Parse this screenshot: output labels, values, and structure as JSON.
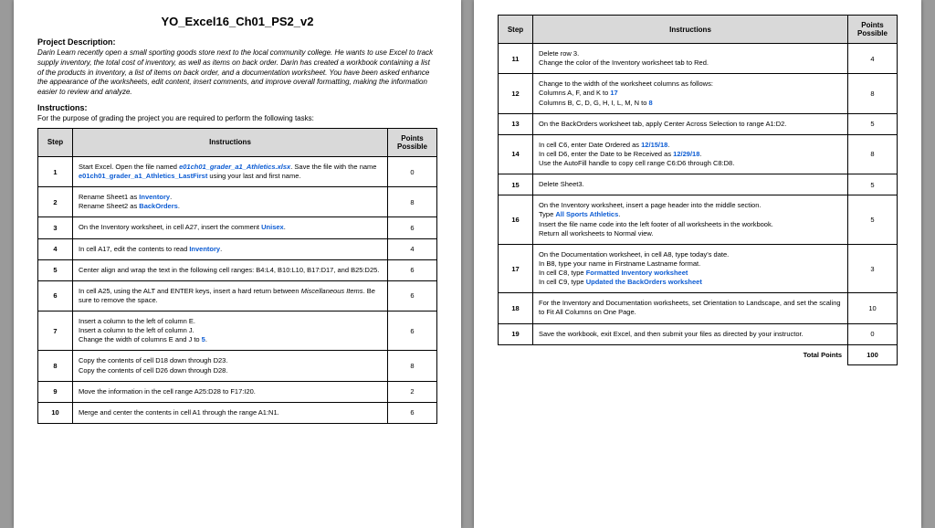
{
  "doc": {
    "title": "YO_Excel16_Ch01_PS2_v2",
    "project_description_heading": "Project Description:",
    "project_description": "Darin Learn recently open a small sporting goods store next to the local community college. He wants to use Excel to track supply inventory, the total cost of inventory, as well as items on back order. Darin has created a workbook containing a list of the products in inventory, a list of items on back order, and a documentation worksheet. You have been asked enhance the appearance of the worksheets, edit content, insert comments, and improve overall formatting, making the information easier to review and analyze.",
    "instructions_heading": "Instructions:",
    "instructions_lead": "For the purpose of grading the project you are required to perform the following tasks:",
    "col_step": "Step",
    "col_instructions": "Instructions",
    "col_points": "Points Possible",
    "total_label": "Total Points",
    "total_value": "100"
  },
  "steps1": [
    {
      "n": "1",
      "pts": "0",
      "l1": "Start Excel. Open the file named ",
      "f1": "e01ch01_grader_a1_Athletics.xlsx",
      "l2": ". Save the file with the name ",
      "f2": "e01ch01_grader_a1_Athletics_LastFirst",
      "l3": " using your last and first name."
    },
    {
      "n": "2",
      "pts": "8",
      "l1": "Rename Sheet1 as ",
      "k1": "Inventory",
      "l2": ".",
      "l3": "Rename Sheet2 as ",
      "k2": "BackOrders",
      "l4": "."
    },
    {
      "n": "3",
      "pts": "6",
      "l1": "On the Inventory worksheet, in cell A27, insert the comment ",
      "k1": "Unisex",
      "l2": "."
    },
    {
      "n": "4",
      "pts": "4",
      "l1": "In cell A17, edit the contents to read ",
      "k1": "Inventory",
      "l2": "."
    },
    {
      "n": "5",
      "pts": "6",
      "l1": "Center align and wrap the text in the following cell ranges: B4:L4, B10:L10, B17:D17, and B25:D25."
    },
    {
      "n": "6",
      "pts": "6",
      "l1": "In cell A25, using the ALT and ENTER keys, insert a hard return between ",
      "it": "Miscellaneous Items",
      "l2": ". Be sure to remove the space."
    },
    {
      "n": "7",
      "pts": "6",
      "l1": "Insert a column to the left of column E.",
      "l2": "Insert a column to the left of column J.",
      "l3": "Change the width of columns E and J to ",
      "k1": "5",
      "l4": "."
    },
    {
      "n": "8",
      "pts": "8",
      "l1": "Copy the contents of cell D18 down through D23.",
      "l2": "Copy the contents of cell D26 down through D28."
    },
    {
      "n": "9",
      "pts": "2",
      "l1": "Move the information in the cell range A25:D28 to F17:I20."
    },
    {
      "n": "10",
      "pts": "6",
      "l1": "Merge and center the contents in cell A1 through the range A1:N1."
    }
  ],
  "steps2": [
    {
      "n": "11",
      "pts": "4",
      "l1": "Delete row 3.",
      "l2": "Change the color of the Inventory worksheet tab to Red."
    },
    {
      "n": "12",
      "pts": "8",
      "l1": "Change to the width of the worksheet columns as follows:",
      "l2": "Columns A, F, and K to ",
      "k1": "17",
      "l3": "Columns B, C, D, G, H, I, L, M, N to ",
      "k2": "8"
    },
    {
      "n": "13",
      "pts": "5",
      "l1": "On the BackOrders worksheet tab, apply Center Across Selection to range A1:D2."
    },
    {
      "n": "14",
      "pts": "8",
      "l1": "In cell C6, enter Date Ordered as ",
      "k1": "12/15/18",
      "l2": ".",
      "l3": "In cell D6, enter the Date to be Received as ",
      "k2": "12/29/18",
      "l4": ".",
      "l5": "Use the AutoFill handle to copy cell range C6:D6 through C8:D8."
    },
    {
      "n": "15",
      "pts": "5",
      "l1": "Delete Sheet3."
    },
    {
      "n": "16",
      "pts": "5",
      "l1": "On the Inventory worksheet, insert a page header into the middle section.",
      "l2": "Type ",
      "k1": "All Sports Athletics",
      "l3": ".",
      "l4": "Insert the file name code into the left footer of all worksheets in the workbook.",
      "l5": "Return all worksheets to Normal view."
    },
    {
      "n": "17",
      "pts": "3",
      "l1": "On the Documentation worksheet, in cell A8, type today's date.",
      "l2": "In B8, type your name in Firstname Lastname format.",
      "l3": "In cell C8, type ",
      "k1": "Formatted Inventory worksheet",
      "l4": "In cell C9, type ",
      "k2": "Updated the BackOrders worksheet"
    },
    {
      "n": "18",
      "pts": "10",
      "l1": "For the Inventory and Documentation worksheets, set Orientation to Landscape, and set the scaling to Fit All Columns on One Page."
    },
    {
      "n": "19",
      "pts": "0",
      "l1": "Save the workbook, exit Excel, and then submit your files as directed by your instructor."
    }
  ]
}
